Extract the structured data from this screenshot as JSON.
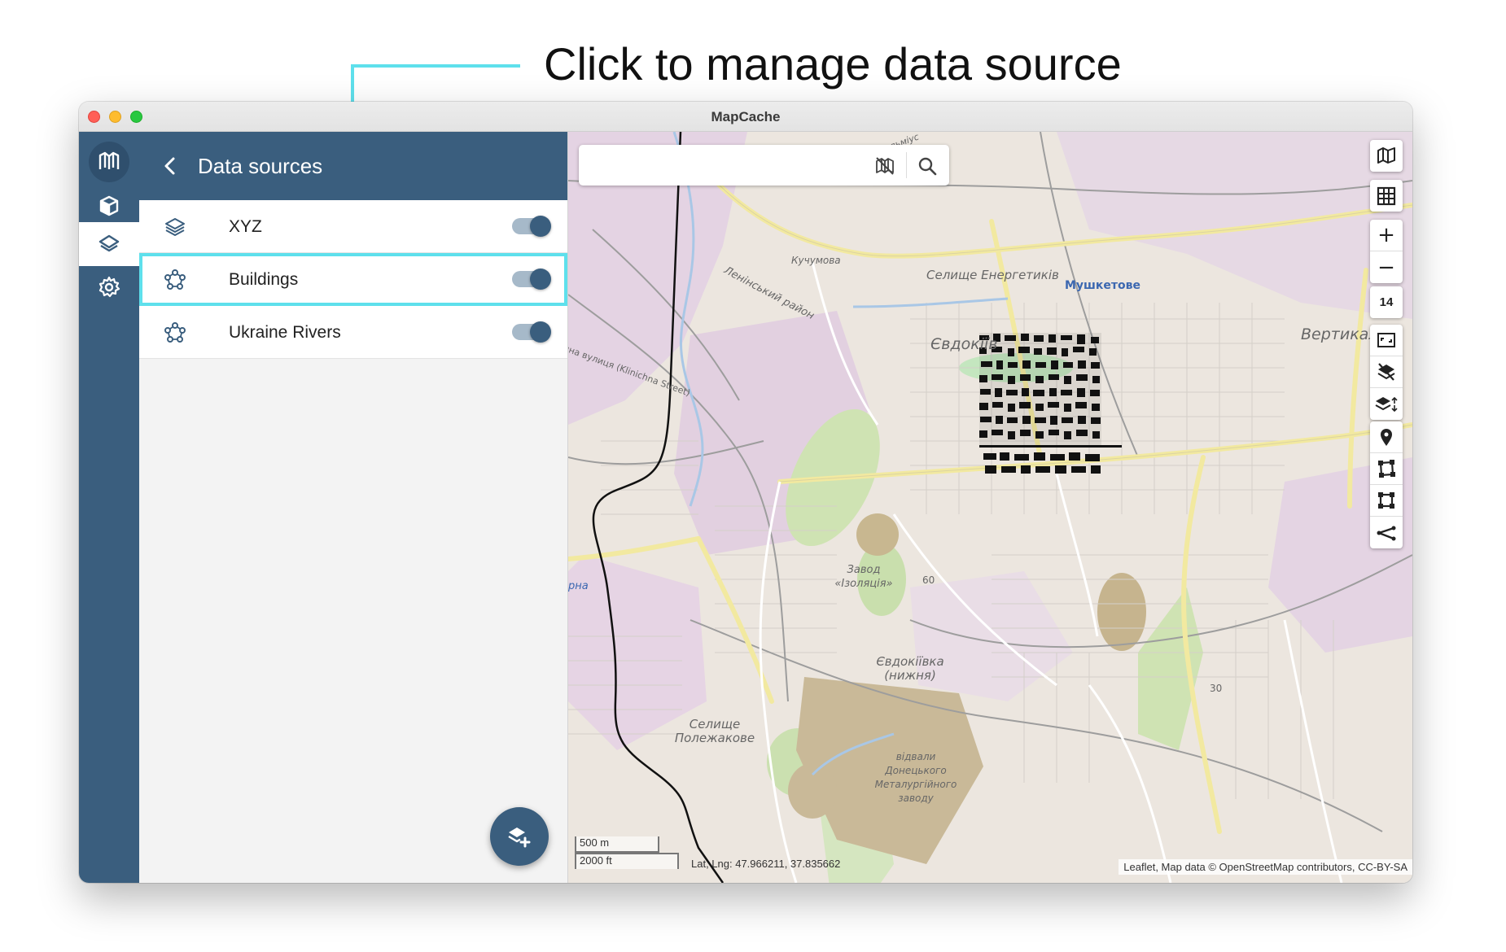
{
  "callout": {
    "text": "Click to manage data source"
  },
  "window": {
    "title": "MapCache"
  },
  "rail": {
    "items": [
      {
        "icon": "cube-icon"
      },
      {
        "icon": "layers-icon",
        "active": true
      },
      {
        "icon": "gear-icon"
      }
    ]
  },
  "panel": {
    "title": "Data sources",
    "sources": [
      {
        "label": "XYZ",
        "icon": "layers-icon",
        "enabled": true
      },
      {
        "label": "Buildings",
        "icon": "feature-icon",
        "enabled": true,
        "highlighted": true
      },
      {
        "label": "Ukraine Rivers",
        "icon": "feature-icon",
        "enabled": true
      }
    ]
  },
  "map": {
    "search": {
      "value": "",
      "placeholder": ""
    },
    "zoom_level": "14",
    "scale": {
      "metric": "500 m",
      "imperial": "2000 ft"
    },
    "coordinates": "Lat, Lng: 47.966211, 37.835662",
    "attribution": "Leaflet, Map data © OpenStreetMap contributors, CC-BY-SA",
    "labels": {
      "selyshche_enerhetykiv": "Селище Енергетиків",
      "mushketove": "Мушкетове",
      "yevdokiivka": "Євдокіїв",
      "vertykal": "Вертикал",
      "kuchumova": "Кучумова",
      "leninskyi": "Ленінський район",
      "zavod_izolyatsiya": "Завод «Ізоляція»",
      "yevdokiivka_nyzhnia": "Євдокіївка (нижня)",
      "selyshche_polezhakove": "Селище Полежакове",
      "vidvaly": "відвали Донецького Металургійного заводу",
      "height_60": "60",
      "height_30": "30",
      "street_klinichna": "чна вулиця (Klinichna Street)",
      "kalmiusa": "Кальміус",
      "rna": "рна"
    }
  }
}
